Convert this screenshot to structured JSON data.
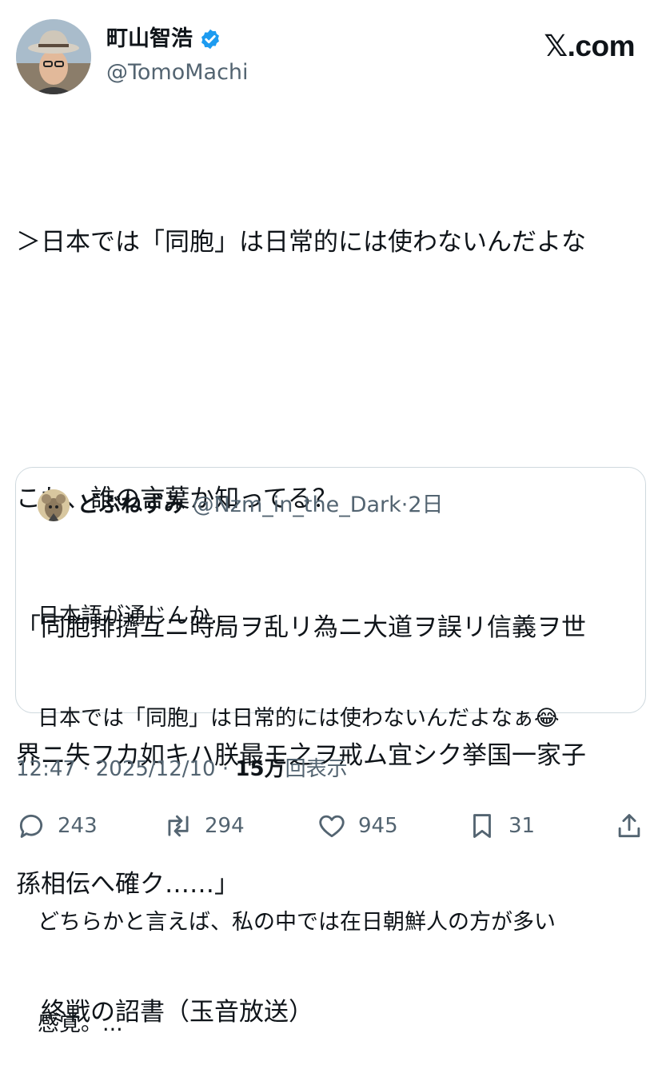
{
  "author": {
    "name": "町山智浩",
    "handle": "@TomoMachi",
    "verified_icon": "verified-badge-icon"
  },
  "brand": "𝕏.com",
  "post": {
    "lines": [
      "＞日本では「同胞」は日常的には使わないんだよな",
      "",
      "これ、誰の言葉か知ってる？",
      "「同胞排擠互ニ時局ヲ乱リ為ニ大道ヲ誤リ信義ヲ世",
      "界ニ失フカ如キハ朕最モ之ヲ戒ム宜シク挙国一家子",
      "孫相伝へ確ク……」",
      "　終戦の詔書（玉音放送）"
    ]
  },
  "quote": {
    "name": "どぶねずみ",
    "handle": "@Nzm_in_the_Dark",
    "separator": "·",
    "time": "2日",
    "lines": [
      "日本語が通じんか‥",
      "日本では「同胞」は日常的には使わないんだよなぁ😂",
      "",
      "どちらかと言えば、私の中では在日朝鮮人の方が多い",
      "感覚。..."
    ]
  },
  "meta": {
    "time": "12:47",
    "sep1": " · ",
    "date": "2025/12/10",
    "sep2": " · ",
    "views_count": "15万",
    "views_label": "回表示"
  },
  "actions": {
    "reply": "243",
    "retweet": "294",
    "like": "945",
    "bookmark": "31"
  },
  "colors": {
    "text": "#0f1419",
    "secondary": "#536471",
    "verified": "#1d9bf0",
    "border": "#cfd9de"
  }
}
